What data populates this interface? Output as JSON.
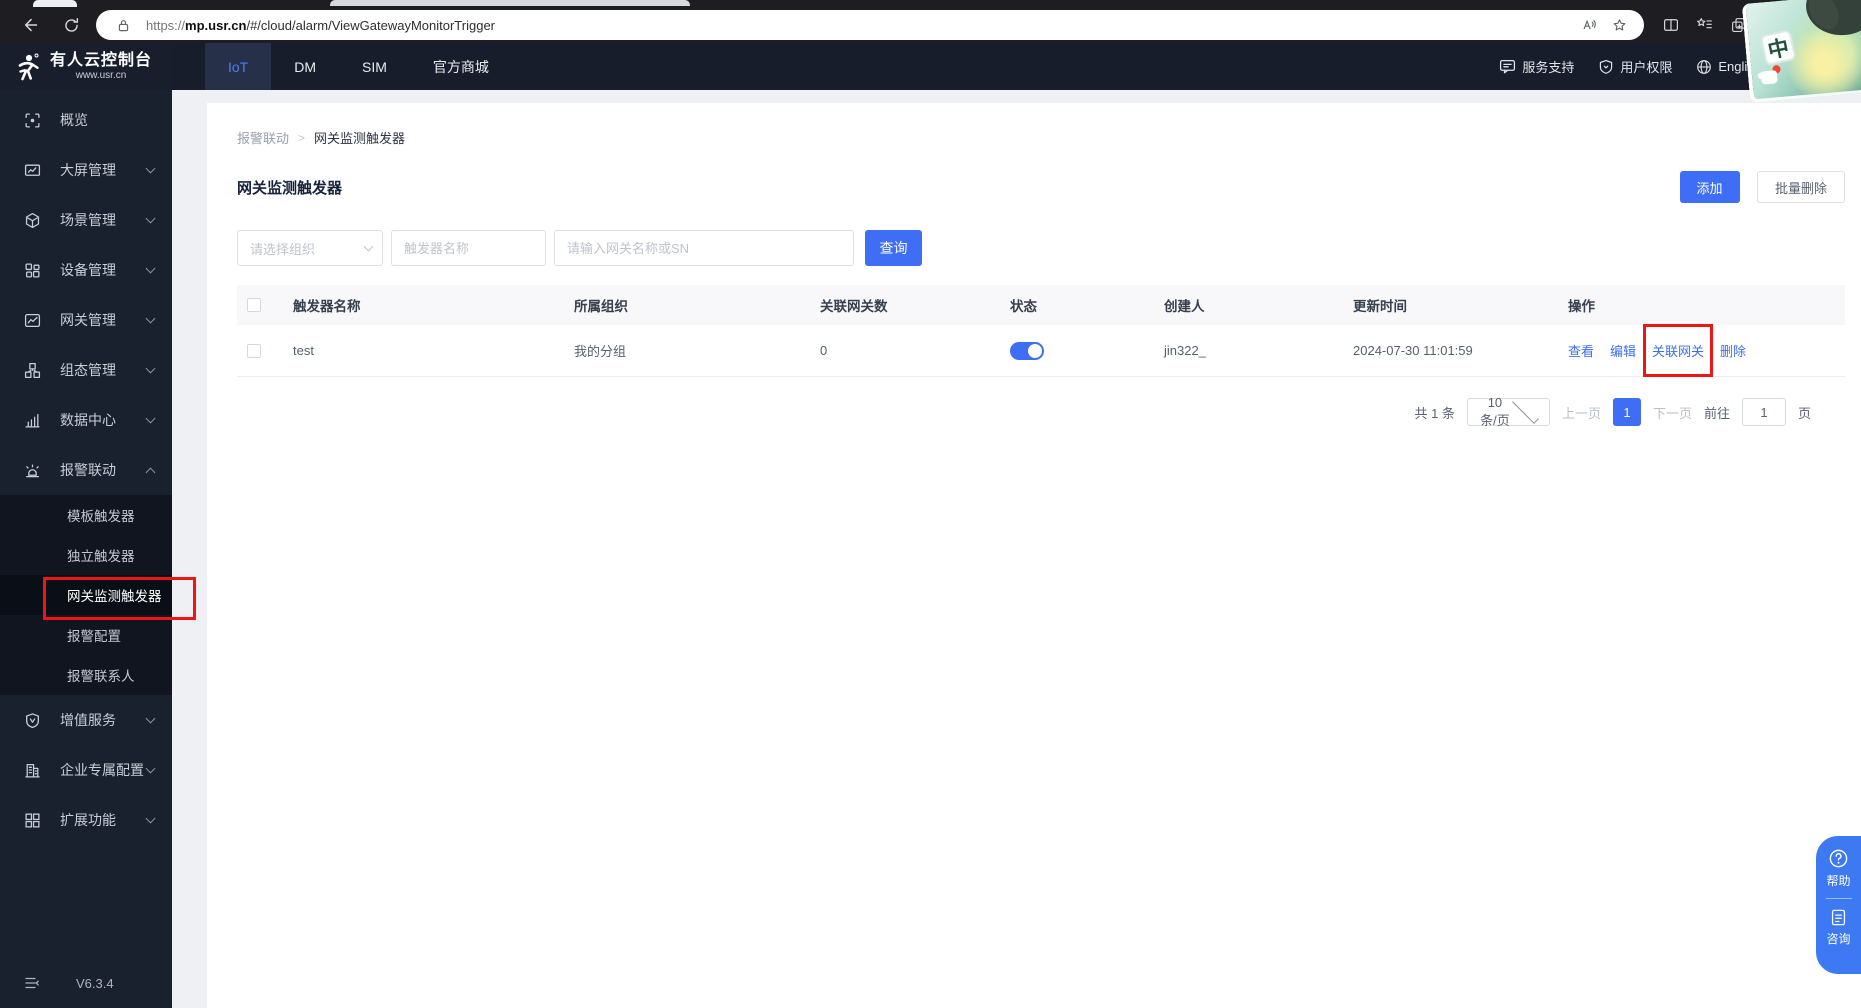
{
  "browser": {
    "url_scheme": "https://",
    "url_host": "mp.usr.cn",
    "url_path": "/#/cloud/alarm/ViewGatewayMonitorTrigger"
  },
  "header": {
    "logo_title": "有人云控制台",
    "logo_subtitle": "www.usr.cn",
    "tabs": [
      {
        "label": "IoT",
        "active": true
      },
      {
        "label": "DM",
        "active": false
      },
      {
        "label": "SIM",
        "active": false
      },
      {
        "label": "官方商城",
        "active": false
      }
    ],
    "support_label": "服务支持",
    "permissions_label": "用户权限",
    "language_label": "English",
    "avatar_badge": "中"
  },
  "sidebar": {
    "items": [
      {
        "label": "概览",
        "icon": "overview-icon"
      },
      {
        "label": "大屏管理",
        "icon": "screen-icon"
      },
      {
        "label": "场景管理",
        "icon": "scene-icon"
      },
      {
        "label": "设备管理",
        "icon": "device-icon"
      },
      {
        "label": "网关管理",
        "icon": "gateway-icon"
      },
      {
        "label": "组态管理",
        "icon": "configuration-icon"
      },
      {
        "label": "数据中心",
        "icon": "data-center-icon"
      },
      {
        "label": "报警联动",
        "icon": "alarm-icon",
        "expanded": true,
        "children": [
          "模板触发器",
          "独立触发器",
          "网关监测触发器",
          "报警配置",
          "报警联系人"
        ],
        "active_child": "网关监测触发器"
      },
      {
        "label": "增值服务",
        "icon": "value-added-icon"
      },
      {
        "label": "企业专属配置",
        "icon": "enterprise-icon"
      },
      {
        "label": "扩展功能",
        "icon": "extension-icon"
      }
    ],
    "version": "V6.3.4"
  },
  "main": {
    "breadcrumb": {
      "parent": "报警联动",
      "separator": ">",
      "current": "网关监测触发器"
    },
    "page_title": "网关监测触发器",
    "toolbar": {
      "add_label": "添加",
      "batch_delete_label": "批量删除"
    },
    "filters": {
      "org_select_placeholder": "请选择组织",
      "trigger_name_placeholder": "触发器名称",
      "gateway_placeholder": "请输入网关名称或SN",
      "search_label": "查询"
    },
    "table": {
      "columns": [
        "触发器名称",
        "所属组织",
        "关联网关数",
        "状态",
        "创建人",
        "更新时间",
        "操作"
      ],
      "rows": [
        {
          "name": "test",
          "org": "我的分组",
          "gateway_count": "0",
          "status_on": true,
          "creator": "jin322_",
          "updated": "2024-07-30 11:01:59",
          "actions": {
            "view": "查看",
            "edit": "编辑",
            "link_gateway": "关联网关",
            "delete": "删除"
          }
        }
      ]
    },
    "pagination": {
      "total": "共 1 条",
      "page_size": "10条/页",
      "prev": "上一页",
      "current_page": "1",
      "next": "下一页",
      "goto_label": "前往",
      "goto_value": "1",
      "goto_unit": "页"
    }
  },
  "float_widget": {
    "help_label": "帮助",
    "consult_label": "咨询"
  },
  "colors": {
    "accent": "#3d6ef5",
    "annotation_red": "#f01414",
    "toggle_on": "#3d6ef5",
    "header_bg": "#171d2a",
    "sidebar_bg": "#1a212e"
  }
}
